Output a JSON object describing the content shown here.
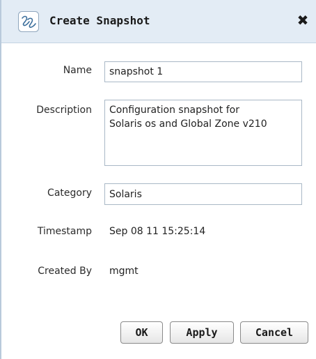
{
  "dialog": {
    "title": "Create Snapshot",
    "close_label": "✖",
    "icon": "app-logo-icon"
  },
  "form": {
    "name_label": "Name",
    "name_value": "snapshot 1",
    "description_label": "Description",
    "description_value": "Configuration snapshot for\nSolaris os and Global Zone v210",
    "category_label": "Category",
    "category_value": "Solaris",
    "timestamp_label": "Timestamp",
    "timestamp_value": "Sep 08 11 15:25:14",
    "created_by_label": "Created By",
    "created_by_value": "mgmt"
  },
  "buttons": {
    "ok": "OK",
    "apply": "Apply",
    "cancel": "Cancel"
  },
  "colors": {
    "titlebar_bg": "#e3ecf5",
    "input_border": "#a9b8c6"
  }
}
